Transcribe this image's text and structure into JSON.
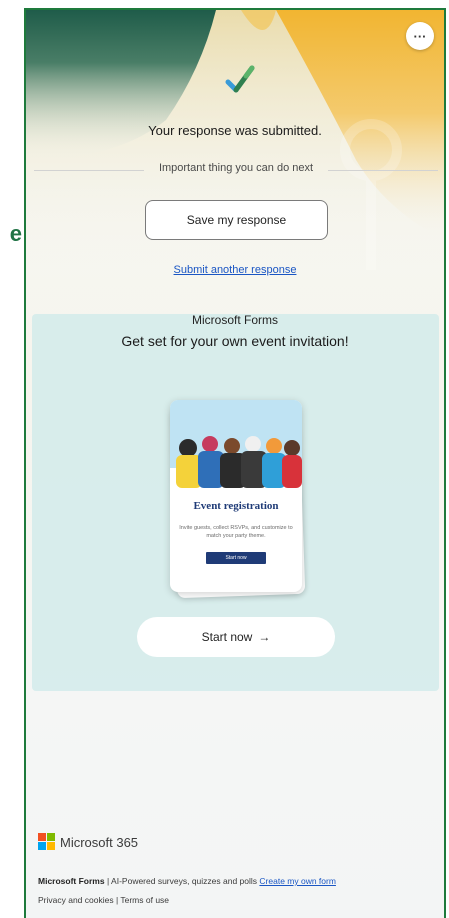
{
  "page": {
    "edge_fragment": "e"
  },
  "header": {
    "more_label": "···"
  },
  "confirmation": {
    "title": "Your response was submitted.",
    "next_steps_label": "Important thing you can do next",
    "save_button_label": "Save my response",
    "submit_another_label": "Submit another response"
  },
  "promo": {
    "brand": "Microsoft Forms",
    "headline": "Get set for your own event invitation!",
    "card": {
      "title": "Event registration",
      "description": "Invite guests, collect RSVPs, and customize to match your party theme.",
      "button_label": "Start now"
    },
    "start_button_label": "Start now",
    "start_button_arrow": "→"
  },
  "footer": {
    "product": "Microsoft 365",
    "brand_bold": "Microsoft Forms",
    "tagline": " | AI-Powered surveys, quizzes and polls ",
    "create_link": "Create my own form",
    "privacy_link": "Privacy and cookies",
    "separator": " | ",
    "terms_link": "Terms of use"
  },
  "colors": {
    "frame_border": "#1e7a3c",
    "link": "#1a56c4",
    "banner_dark": "#1f5c4a",
    "banner_yellow": "#f2b531",
    "promo_card_bg": "#cee9ea",
    "event_title": "#1f3b77",
    "ms_logo": [
      "#f25022",
      "#7fba00",
      "#00a4ef",
      "#ffb900"
    ]
  },
  "icons": {
    "check": "checkmark-icon",
    "more": "more-horizontal-icon",
    "arrow": "arrow-right-icon",
    "logo": "microsoft-logo-icon"
  }
}
